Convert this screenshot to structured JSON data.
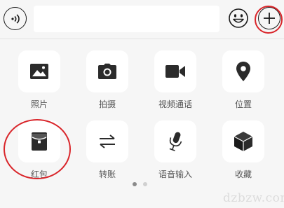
{
  "top_bar": {
    "input_value": "",
    "voice_icon": "voice-input-icon",
    "emoji_icon": "emoji-icon",
    "plus_icon": "plus-icon"
  },
  "grid": {
    "items": [
      {
        "label": "照片",
        "icon": "photo-icon"
      },
      {
        "label": "拍摄",
        "icon": "camera-icon"
      },
      {
        "label": "视频通话",
        "icon": "video-call-icon"
      },
      {
        "label": "位置",
        "icon": "location-icon"
      },
      {
        "label": "红包",
        "icon": "red-packet-icon"
      },
      {
        "label": "转账",
        "icon": "transfer-icon"
      },
      {
        "label": "语音输入",
        "icon": "microphone-icon"
      },
      {
        "label": "收藏",
        "icon": "favorites-icon"
      }
    ]
  },
  "pagination": {
    "pages": 2,
    "current": 1
  },
  "watermark": "dzbzw.com",
  "colors": {
    "highlight_ring": "#d9252a",
    "icon": "#1b1b1b",
    "background": "#f6f6f6",
    "tile": "#ffffff"
  }
}
